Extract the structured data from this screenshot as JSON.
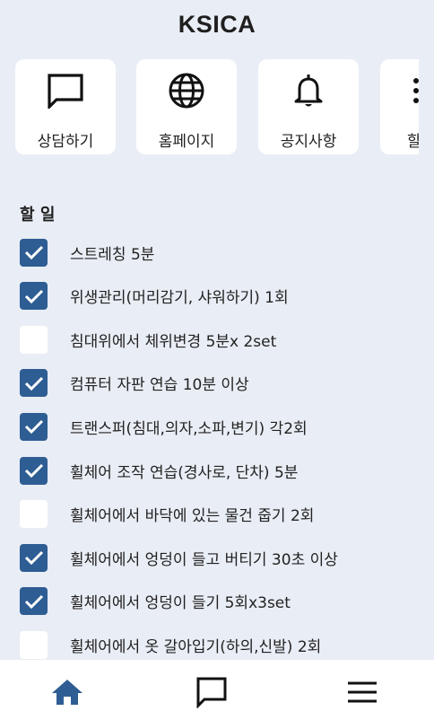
{
  "app": {
    "title": "KSICA"
  },
  "quick_menu": [
    {
      "label": "상담하기",
      "icon": "chat-bubble-icon"
    },
    {
      "label": "홈페이지",
      "icon": "globe-icon"
    },
    {
      "label": "공지사항",
      "icon": "bell-icon"
    },
    {
      "label": "할",
      "icon": "more-vert-icon"
    }
  ],
  "todo": {
    "heading": "할 일",
    "items": [
      {
        "label": "스트레칭 5분",
        "checked": true
      },
      {
        "label": "위생관리(머리감기, 샤워하기) 1회",
        "checked": true
      },
      {
        "label": "침대위에서 체위변경 5분x 2set",
        "checked": false
      },
      {
        "label": "컴퓨터 자판 연습 10분 이상",
        "checked": true
      },
      {
        "label": "트랜스퍼(침대,의자,소파,변기) 각2회",
        "checked": true
      },
      {
        "label": "휠체어 조작 연습(경사로, 단차) 5분",
        "checked": true
      },
      {
        "label": "휠체어에서 바닥에 있는 물건 줍기 2회",
        "checked": false
      },
      {
        "label": "휠체어에서 엉덩이 들고 버티기 30초 이상",
        "checked": true
      },
      {
        "label": "휠체어에서 엉덩이 들기 5회x3set",
        "checked": true
      },
      {
        "label": "휠체어에서 옷 갈아입기(하의,신발) 2회",
        "checked": false
      }
    ]
  },
  "bottom_nav": [
    {
      "icon": "home-icon",
      "active": true
    },
    {
      "icon": "chat-bubble-icon",
      "active": false
    },
    {
      "icon": "menu-icon",
      "active": false
    }
  ],
  "colors": {
    "accent": "#2e5d93",
    "background": "#e9edf5",
    "card": "#ffffff"
  }
}
